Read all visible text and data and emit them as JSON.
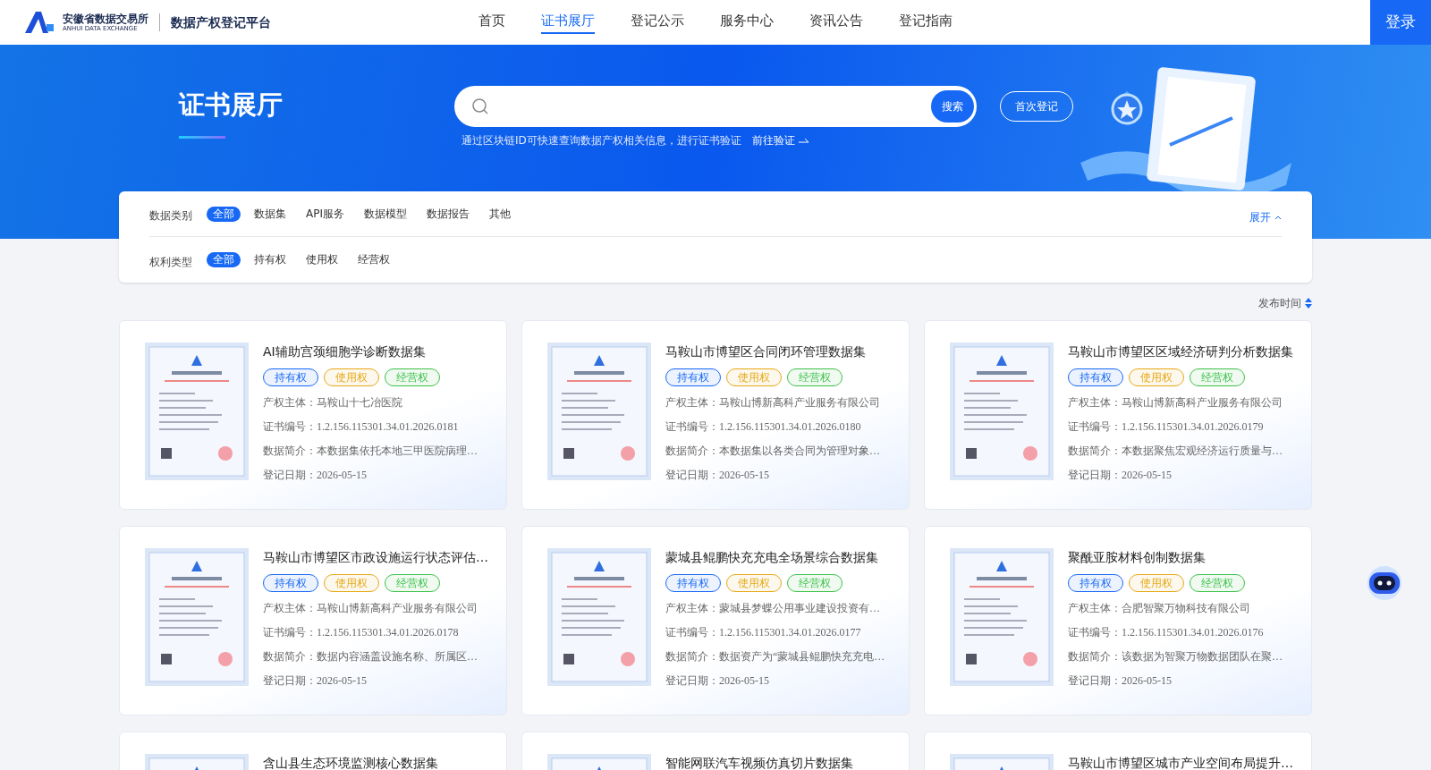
{
  "header": {
    "logo_name": "安徽省数据交易所",
    "logo_sub": "ANHUI DATA EXCHANGE",
    "platform": "数据产权登记平台",
    "nav": [
      {
        "label": "首页",
        "selected": false
      },
      {
        "label": "证书展厅",
        "selected": true
      },
      {
        "label": "登记公示",
        "selected": false
      },
      {
        "label": "服务中心",
        "selected": false
      },
      {
        "label": "资讯公告",
        "selected": false
      },
      {
        "label": "登记指南",
        "selected": false
      }
    ],
    "login": "登录"
  },
  "hero": {
    "title": "证书展厅",
    "search_button": "搜索",
    "register_button": "首次登记",
    "hint": "通过区块链ID可快速查询数据产权相关信息，进行证书验证",
    "verify_link": "前往验证"
  },
  "filters": [
    {
      "label": "数据类别",
      "toggle": "展开",
      "options": [
        {
          "label": "全部",
          "selected": true
        },
        {
          "label": "数据集",
          "selected": false
        },
        {
          "label": "API服务",
          "selected": false
        },
        {
          "label": "数据模型",
          "selected": false
        },
        {
          "label": "数据报告",
          "selected": false
        },
        {
          "label": "其他",
          "selected": false
        }
      ]
    },
    {
      "label": "权利类型",
      "options": [
        {
          "label": "全部",
          "selected": true
        },
        {
          "label": "持有权",
          "selected": false
        },
        {
          "label": "使用权",
          "selected": false
        },
        {
          "label": "经营权",
          "selected": false
        }
      ]
    }
  ],
  "sort": {
    "label": "发布时间"
  },
  "cards": [
    {
      "title": "AI辅助宫颈细胞学诊断数据集",
      "tags": [
        {
          "label": "持有权",
          "color": "#1668f5"
        },
        {
          "label": "使用权",
          "color": "#e6a817"
        },
        {
          "label": "经营权",
          "color": "#3cc24a"
        }
      ],
      "fields": [
        {
          "label": "产权主体：",
          "value": "马鞍山十七冶医院"
        },
        {
          "label": "证书编号：",
          "value": "1.2.156.115301.34.01.2026.0181"
        },
        {
          "label": "数据简介：",
          "value": "本数据集依托本地三甲医院病理…"
        },
        {
          "label": "登记日期：",
          "value": "2026-05-15"
        }
      ]
    },
    {
      "title": "马鞍山市博望区合同闭环管理数据集",
      "tags": [
        {
          "label": "持有权",
          "color": "#1668f5"
        },
        {
          "label": "使用权",
          "color": "#e6a817"
        },
        {
          "label": "经营权",
          "color": "#3cc24a"
        }
      ],
      "fields": [
        {
          "label": "产权主体：",
          "value": "马鞍山博新高科产业服务有限公司"
        },
        {
          "label": "证书编号：",
          "value": "1.2.156.115301.34.01.2026.0180"
        },
        {
          "label": "数据简介：",
          "value": "本数据集以各类合同为管理对象…"
        },
        {
          "label": "登记日期：",
          "value": "2026-05-15"
        }
      ]
    },
    {
      "title": "马鞍山市博望区区域经济研判分析数据集",
      "tags": [
        {
          "label": "持有权",
          "color": "#1668f5"
        },
        {
          "label": "使用权",
          "color": "#e6a817"
        },
        {
          "label": "经营权",
          "color": "#3cc24a"
        }
      ],
      "fields": [
        {
          "label": "产权主体：",
          "value": "马鞍山博新高科产业服务有限公司"
        },
        {
          "label": "证书编号：",
          "value": "1.2.156.115301.34.01.2026.0179"
        },
        {
          "label": "数据简介：",
          "value": "本数据聚焦宏观经济运行质量与…"
        },
        {
          "label": "登记日期：",
          "value": "2026-05-15"
        }
      ]
    },
    {
      "title": "马鞍山市博望区市政设施运行状态评估…",
      "tags": [
        {
          "label": "持有权",
          "color": "#1668f5"
        },
        {
          "label": "使用权",
          "color": "#e6a817"
        },
        {
          "label": "经营权",
          "color": "#3cc24a"
        }
      ],
      "fields": [
        {
          "label": "产权主体：",
          "value": "马鞍山博新高科产业服务有限公司"
        },
        {
          "label": "证书编号：",
          "value": "1.2.156.115301.34.01.2026.0178"
        },
        {
          "label": "数据简介：",
          "value": "数据内容涵盖设施名称、所属区…"
        },
        {
          "label": "登记日期：",
          "value": "2026-05-15"
        }
      ]
    },
    {
      "title": "蒙城县鲲鹏快充充电全场景综合数据集",
      "tags": [
        {
          "label": "持有权",
          "color": "#1668f5"
        },
        {
          "label": "使用权",
          "color": "#e6a817"
        },
        {
          "label": "经营权",
          "color": "#3cc24a"
        }
      ],
      "fields": [
        {
          "label": "产权主体：",
          "value": "蒙城县梦蝶公用事业建设投资有…"
        },
        {
          "label": "证书编号：",
          "value": "1.2.156.115301.34.01.2026.0177"
        },
        {
          "label": "数据简介：",
          "value": "数据资产为“蒙城县鲲鹏快充充电…"
        },
        {
          "label": "登记日期：",
          "value": "2026-05-15"
        }
      ]
    },
    {
      "title": "聚酰亚胺材料创制数据集",
      "tags": [
        {
          "label": "持有权",
          "color": "#1668f5"
        },
        {
          "label": "使用权",
          "color": "#e6a817"
        },
        {
          "label": "经营权",
          "color": "#3cc24a"
        }
      ],
      "fields": [
        {
          "label": "产权主体：",
          "value": "合肥智聚万物科技有限公司"
        },
        {
          "label": "证书编号：",
          "value": "1.2.156.115301.34.01.2026.0176"
        },
        {
          "label": "数据简介：",
          "value": "该数据为智聚万物数据团队在聚…"
        },
        {
          "label": "登记日期：",
          "value": "2026-05-15"
        }
      ]
    },
    {
      "title": "含山县生态环境监测核心数据集"
    },
    {
      "title": "智能网联汽车视频仿真切片数据集"
    },
    {
      "title": "马鞍山市博望区城市产业空间布局提升…"
    }
  ]
}
